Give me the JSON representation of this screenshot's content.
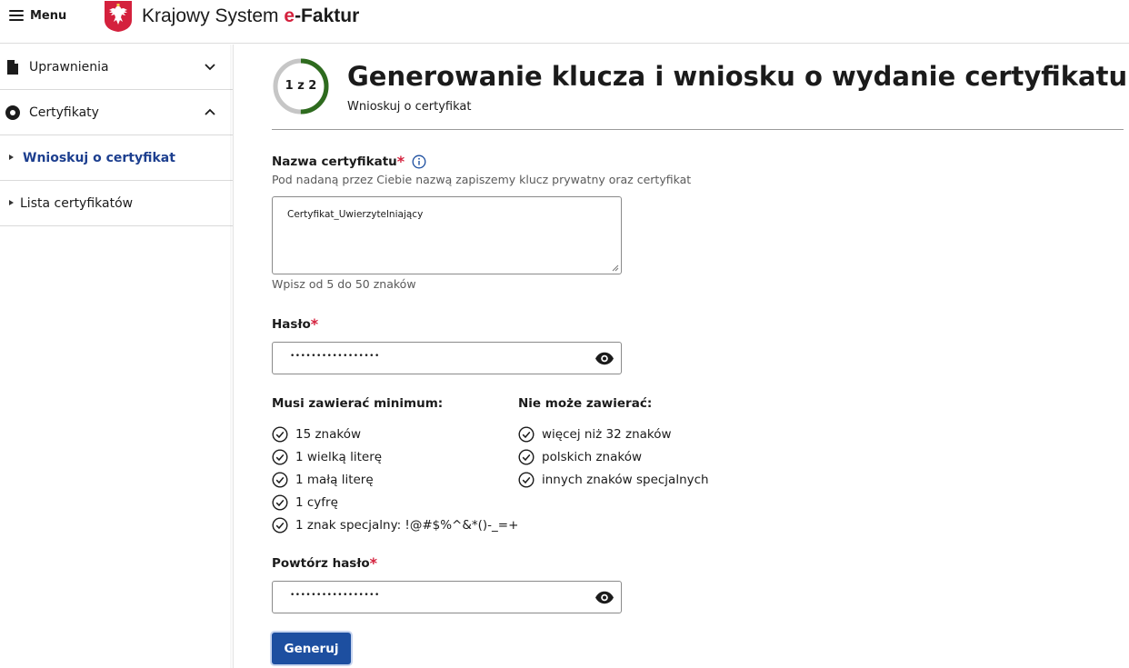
{
  "topbar": {
    "menu_label": "Menu",
    "brand_prefix": "Krajowy System ",
    "brand_e": "e",
    "brand_suffix": "-Faktur"
  },
  "sidebar": {
    "items": [
      {
        "label": "Uprawnienia",
        "icon": "document-icon",
        "expanded": false
      },
      {
        "label": "Certyfikaty",
        "icon": "certificate-icon",
        "expanded": true
      }
    ],
    "subitems": [
      {
        "label": "Wnioskuj o certyfikat",
        "active": true
      },
      {
        "label": "Lista certyfikatów",
        "active": false
      }
    ]
  },
  "header": {
    "step_text": "1 z 2",
    "step_progress": 0.5,
    "title": "Generowanie klucza i wniosku o wydanie certyfikatu",
    "subtitle": "Wnioskuj o certyfikat"
  },
  "form": {
    "cert_name": {
      "label": "Nazwa certyfikatu",
      "required_mark": "*",
      "description": "Pod nadaną przez Ciebie nazwą zapiszemy klucz prywatny oraz certyfikat",
      "value": "Certyfikat_Uwierzytelniający",
      "hint": "Wpisz od 5 do 50 znaków"
    },
    "password": {
      "label": "Hasło",
      "required_mark": "*",
      "masked_value": "•••••••••••••••••"
    },
    "must_contain": {
      "heading": "Musi zawierać minimum:",
      "rules": [
        "15 znaków",
        "1 wielką literę",
        "1 małą literę",
        "1 cyfrę",
        "1 znak specjalny: !@#$%^&*()-_=+"
      ]
    },
    "must_not_contain": {
      "heading": "Nie może zawierać:",
      "rules": [
        "więcej niż 32 znaków",
        "polskich znaków",
        "innych znaków specjalnych"
      ]
    },
    "repeat_password": {
      "label": "Powtórz hasło",
      "required_mark": "*",
      "masked_value": "•••••••••••••••••"
    },
    "submit_label": "Generuj"
  },
  "colors": {
    "accent_blue": "#1d4fa0",
    "active_link": "#1d3f8f",
    "required_red": "#d4213d",
    "progress_green": "#2e6b1e",
    "progress_track": "#c6c6c6"
  }
}
